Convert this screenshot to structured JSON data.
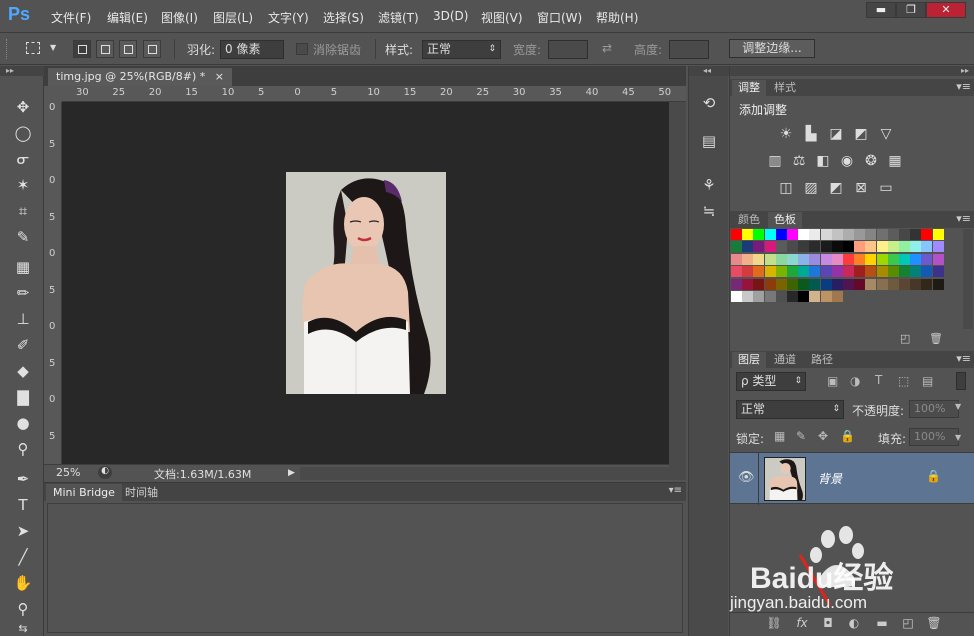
{
  "app": {
    "logo": "Ps"
  },
  "menu": [
    "文件(F)",
    "编辑(E)",
    "图像(I)",
    "图层(L)",
    "文字(Y)",
    "选择(S)",
    "滤镜(T)",
    "3D(D)",
    "视图(V)",
    "窗口(W)",
    "帮助(H)"
  ],
  "window_controls": {
    "minimize": "▬",
    "restore": "❐",
    "close": "✕"
  },
  "options": {
    "feather_label": "羽化:",
    "feather_value": "0 像素",
    "antialias_label": "消除锯齿",
    "style_label": "样式:",
    "style_value": "正常",
    "width_label": "宽度:",
    "height_label": "高度:",
    "refine_edge": "调整边缘..."
  },
  "document": {
    "tab_title": "timg.jpg @ 25%(RGB/8#) *",
    "tab_close": "×",
    "ruler_top": [
      "30",
      "25",
      "20",
      "15",
      "10",
      "5",
      "0",
      "5",
      "10",
      "15",
      "20",
      "25",
      "30",
      "35",
      "40",
      "45",
      "50"
    ],
    "ruler_left": [
      "0",
      "5",
      "0",
      "5",
      "0",
      "5",
      "0",
      "5",
      "0",
      "5"
    ],
    "zoom": "25%",
    "doc_info": "文档:1.63M/1.63M"
  },
  "bridge": {
    "tab1": "Mini Bridge",
    "tab2": "时间轴"
  },
  "adjust_panel": {
    "tab1": "调整",
    "tab2": "样式",
    "heading": "添加调整"
  },
  "color_panel": {
    "tab1": "颜色",
    "tab2": "色板"
  },
  "layers_panel": {
    "tab1": "图层",
    "tab2": "通道",
    "tab3": "路径",
    "filter_kind": "ρ 类型",
    "blend_mode": "正常",
    "opacity_label": "不透明度:",
    "opacity_value": "100%",
    "lock_label": "锁定:",
    "fill_label": "填充:",
    "fill_value": "100%",
    "layer_name": "背景"
  },
  "watermark": {
    "brand": "Baidu经验",
    "url": "jingyan.baidu.com"
  },
  "swatch_colors": [
    [
      "#ff0000",
      "#ffff00",
      "#00ff00",
      "#00ffff",
      "#0000ff",
      "#ff00ff",
      "#ffffff",
      "#ebebeb",
      "#d6d6d6",
      "#c2c2c2",
      "#adadad",
      "#999999",
      "#858585",
      "#707070",
      "#5c5c5c",
      "#474747",
      "#333333",
      "#ff0000",
      "#ffff00"
    ],
    [
      "#1a7a3a",
      "#1a3a7a",
      "#7a1a7a",
      "#d9187f",
      "#5b5b5b",
      "#4b4b4b",
      "#3b3b3b",
      "#2b2b2b",
      "#1b1b1b",
      "#0b0b0b",
      "#000000",
      "#ff9e7d",
      "#ffc48a",
      "#ffef8a",
      "#c8f08a",
      "#8ef0a0",
      "#8ef0e8",
      "#8ac4ff",
      "#a08aff"
    ],
    [
      "#e88a8a",
      "#f0b08a",
      "#f0d88a",
      "#c2e08a",
      "#8ad8a0",
      "#8ad8d0",
      "#8ab4e8",
      "#9a8ae0",
      "#c88ae0",
      "#e88ac8",
      "#ff3b3b",
      "#ff7f27",
      "#ffd200",
      "#9ed800",
      "#3bc84b",
      "#00c8b4",
      "#1e90ff",
      "#6a5acd",
      "#b450c8"
    ],
    [
      "#e84b64",
      "#d23c3c",
      "#e06a1e",
      "#d8b400",
      "#7ab400",
      "#1ea83c",
      "#00a896",
      "#1e78dc",
      "#5a46b4",
      "#9632a8",
      "#c8285a",
      "#a01e1e",
      "#b45014",
      "#a88c00",
      "#5a8c00",
      "#148232",
      "#008278",
      "#145ab4",
      "#3c328c"
    ],
    [
      "#782878",
      "#96143c",
      "#781414",
      "#8c3c0a",
      "#7a6400",
      "#3c6400",
      "#0a5a1e",
      "#005a50",
      "#0a3c82",
      "#281e64",
      "#501450",
      "#640a28",
      "#a58a64",
      "#8a6e50",
      "#6e5a3c",
      "#5a4632",
      "#463728",
      "#322819",
      "#1e1a14"
    ],
    [
      "#ffffff",
      "#c8c8c8",
      "#a0a0a0",
      "#787878",
      "#505050",
      "#282828",
      "#000000",
      "#d2b48c",
      "#bc9464",
      "#a07850"
    ]
  ]
}
